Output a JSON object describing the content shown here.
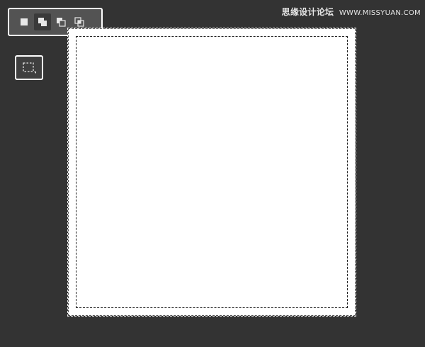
{
  "options_bar": {
    "buttons": [
      {
        "icon": "new-selection-icon",
        "active": false
      },
      {
        "icon": "add-to-selection-icon",
        "active": true
      },
      {
        "icon": "subtract-from-selection-icon",
        "active": false
      },
      {
        "icon": "intersect-selection-icon",
        "active": false
      }
    ]
  },
  "tool": {
    "icon": "rectangular-marquee-icon"
  },
  "watermark": {
    "cn": "思缘设计论坛",
    "url": "WWW.MISSYUAN.COM"
  },
  "colors": {
    "background": "#333333",
    "panel": "#535353",
    "canvas": "#ffffff"
  }
}
